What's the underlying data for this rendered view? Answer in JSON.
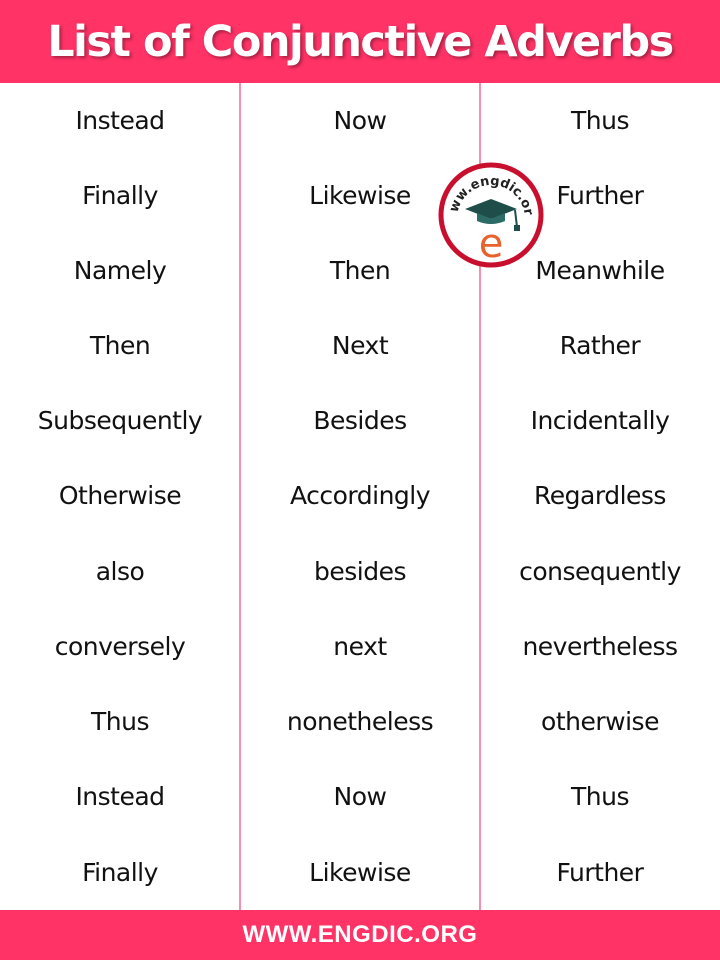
{
  "header": {
    "title": "List of Conjunctive Adverbs"
  },
  "columns": [
    {
      "words": [
        "Instead",
        "Finally",
        "Namely",
        "Then",
        "Subsequently",
        "Otherwise",
        "also",
        "conversely",
        "Thus",
        "Instead",
        "Finally"
      ]
    },
    {
      "words": [
        "Now",
        "Likewise",
        "Then",
        "Next",
        "Besides",
        "Accordingly",
        "besides",
        "next",
        "nonetheless",
        "Now",
        "Likewise"
      ]
    },
    {
      "words": [
        "Thus",
        "Further",
        "Meanwhile",
        "Rather",
        "Incidentally",
        "Regardless",
        "consequently",
        "nevertheless",
        "otherwise",
        "Thus",
        "Further"
      ]
    }
  ],
  "logo": {
    "text": "www.engdic.org",
    "icon": "graduation-cap-e-logo"
  },
  "footer": {
    "text": "WWW.ENGDIC.ORG"
  },
  "colors": {
    "brand": "#ff3366",
    "divider": "#f48fb1",
    "logo_ring": "#c8102e",
    "logo_e": "#e8632b",
    "logo_cap": "#1f4e4a"
  }
}
